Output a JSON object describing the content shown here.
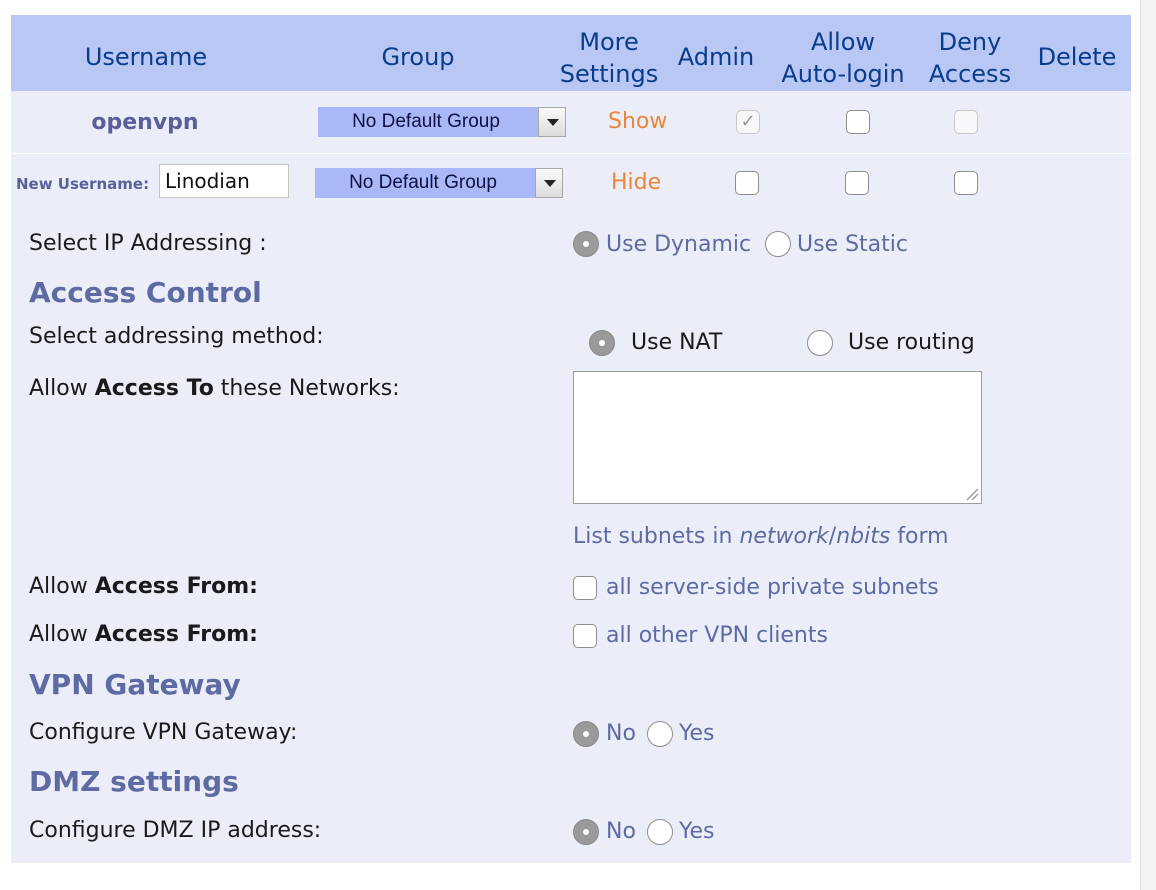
{
  "header": {
    "username": "Username",
    "group": "Group",
    "more_settings_l1": "More",
    "more_settings_l2": "Settings",
    "admin": "Admin",
    "allow_autologin_l1": "Allow",
    "allow_autologin_l2": "Auto-login",
    "deny_access_l1": "Deny",
    "deny_access_l2": "Access",
    "delete": "Delete"
  },
  "rows": [
    {
      "username": "openvpn",
      "group": "No Default Group",
      "settings_link": "Show",
      "admin_checked": true,
      "admin_disabled": true,
      "autologin_checked": false,
      "deny_checked": false,
      "deny_disabled": true
    }
  ],
  "new_user": {
    "label": "New Username:",
    "value": "Linodian",
    "group": "No Default Group",
    "settings_link": "Hide",
    "admin_checked": false,
    "autologin_checked": false,
    "deny_checked": false
  },
  "settings": {
    "ip_addressing": {
      "label": "Select IP Addressing :",
      "options": [
        "Use Dynamic",
        "Use Static"
      ],
      "selected": "Use Dynamic"
    },
    "access_control": {
      "title": "Access Control",
      "method_label": "Select addressing method:",
      "method_options": [
        "Use NAT",
        "Use routing"
      ],
      "method_selected": "Use NAT",
      "access_to_prefix": "Allow ",
      "access_to_bold": "Access To",
      "access_to_suffix": " these Networks:",
      "networks_value": "",
      "hint_prefix": "List subnets in ",
      "hint_italic_1": "network",
      "hint_sep": "/",
      "hint_italic_2": "nbits",
      "hint_suffix": " form",
      "access_from_prefix": "Allow ",
      "access_from_bold": "Access From:",
      "from_server_subnets": "all server-side private subnets",
      "from_vpn_clients": "all other VPN clients"
    },
    "vpn_gateway": {
      "title": "VPN Gateway",
      "label": "Configure VPN Gateway:",
      "options": [
        "No",
        "Yes"
      ],
      "selected": "No"
    },
    "dmz": {
      "title": "DMZ settings",
      "label": "Configure DMZ IP address:",
      "options": [
        "No",
        "Yes"
      ],
      "selected": "No"
    }
  },
  "colors": {
    "header_bg": "#b9c7f4",
    "panel_bg": "#ebeef9",
    "header_text": "#0a3c8c",
    "link": "#e8873a",
    "section": "#5e6aa2",
    "select_bg": "#aab8f8"
  }
}
